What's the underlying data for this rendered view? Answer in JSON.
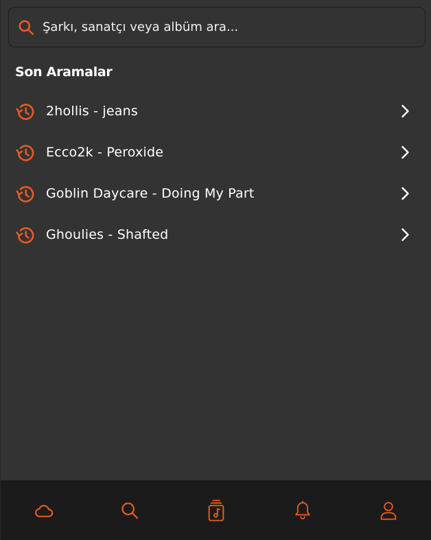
{
  "colors": {
    "accent": "#e95a23",
    "background": "#333333",
    "nav_background": "#1b1b1b",
    "text": "#ffffff"
  },
  "search": {
    "placeholder": "Şarkı, sanatçı veya albüm ara...",
    "value": "",
    "icon": "search-icon"
  },
  "recent": {
    "title": "Son Aramalar",
    "items": [
      {
        "label": "2hollis - jeans",
        "icon": "history-icon",
        "action_icon": "chevron-right-icon"
      },
      {
        "label": "Ecco2k - Peroxide",
        "icon": "history-icon",
        "action_icon": "chevron-right-icon"
      },
      {
        "label": "Goblin Daycare - Doing My Part",
        "icon": "history-icon",
        "action_icon": "chevron-right-icon"
      },
      {
        "label": "Ghoulies - Shafted",
        "icon": "history-icon",
        "action_icon": "chevron-right-icon"
      }
    ]
  },
  "bottom_nav": {
    "items": [
      {
        "icon": "cloud-icon"
      },
      {
        "icon": "search-icon"
      },
      {
        "icon": "music-library-icon"
      },
      {
        "icon": "bell-icon"
      },
      {
        "icon": "user-icon"
      }
    ]
  }
}
